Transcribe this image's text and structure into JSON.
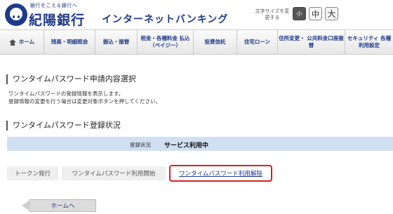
{
  "header": {
    "tagline": "銀行をこえる銀行へ",
    "bank_name": "紀陽銀行",
    "service_name": "インターネットバンキング",
    "fontsize_label": "文字サイズを変更する",
    "fontsize_small": "小",
    "fontsize_medium": "中",
    "fontsize_large": "大"
  },
  "nav": {
    "items": [
      {
        "label": "ホーム"
      },
      {
        "label": "残高・明細照会"
      },
      {
        "label": "振込・振替"
      },
      {
        "label": "税金・各種料金 払込（ペイジー）"
      },
      {
        "label": "投資信託"
      },
      {
        "label": "住宅ローン"
      },
      {
        "label": "住所変更・ 公共料金口座振替"
      },
      {
        "label": "セキュリティ 各種利用設定"
      }
    ]
  },
  "section1": {
    "title": "ワンタイムパスワード申請内容選択",
    "desc_line1": "ワンタイムパスワードの登録情報を表示します。",
    "desc_line2": "登録情報の変更を行う場合は変更対象ボタンを押してください。"
  },
  "section2": {
    "title": "ワンタイムパスワード登録状況",
    "status_label": "登録状況",
    "status_value": "サービス利用中"
  },
  "tabs": {
    "token_issue": "トークン発行",
    "start_use": "ワンタイムパスワード利用開始",
    "cancel_use": "ワンタイムパスワード利用解除"
  },
  "footer": {
    "home_button": "ホームへ"
  }
}
